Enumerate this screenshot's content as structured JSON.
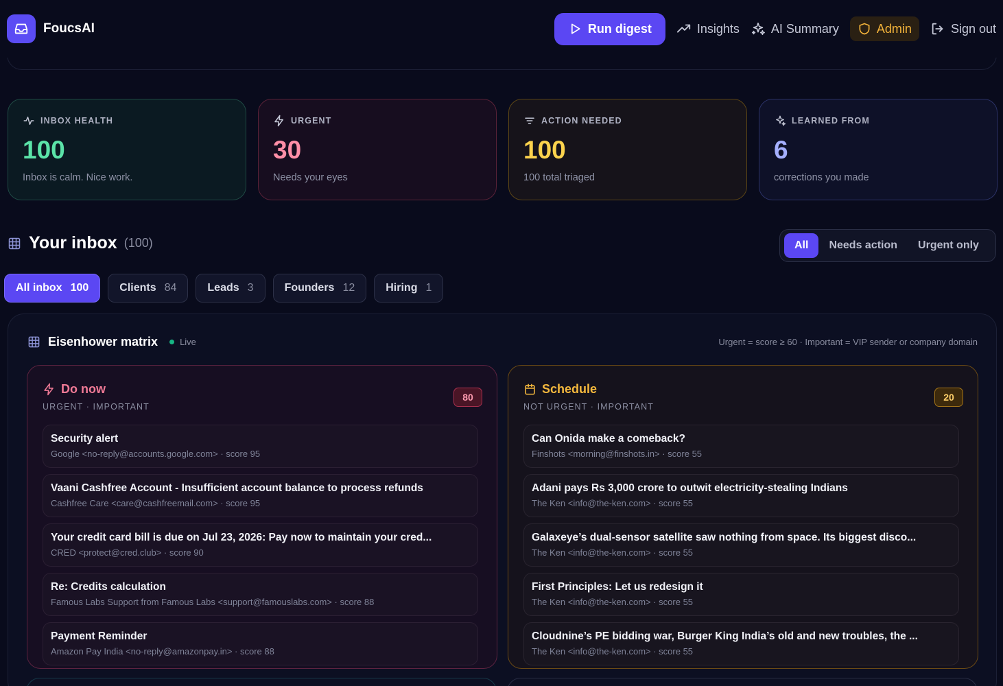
{
  "app": {
    "name": "FoucsAI"
  },
  "nav": {
    "run_digest": "Run digest",
    "insights": "Insights",
    "ai_summary": "AI Summary",
    "admin": "Admin",
    "sign_out": "Sign out"
  },
  "stats": [
    {
      "label": "INBOX HEALTH",
      "value": "100",
      "sub": "Inbox is calm. Nice work.",
      "color": "#5be3a8",
      "border": "#1f4a44",
      "icon": "pulse-icon"
    },
    {
      "label": "URGENT",
      "value": "30",
      "sub": "Needs your eyes",
      "color": "#ff8ea6",
      "border": "#5a2238",
      "icon": "bolt-icon"
    },
    {
      "label": "ACTION NEEDED",
      "value": "100",
      "sub": "100 total triaged",
      "color": "#fcd34d",
      "border": "#5b4516",
      "icon": "filter-icon"
    },
    {
      "label": "LEARNED FROM",
      "value": "6",
      "sub": "corrections you made",
      "color": "#a5b0ff",
      "border": "#2b3266",
      "icon": "sparkles-icon"
    }
  ],
  "inbox": {
    "title": "Your inbox",
    "count": "(100)",
    "segments": [
      "All",
      "Needs action",
      "Urgent only"
    ],
    "chips": [
      {
        "label": "All inbox",
        "n": "100"
      },
      {
        "label": "Clients",
        "n": "84"
      },
      {
        "label": "Leads",
        "n": "3"
      },
      {
        "label": "Founders",
        "n": "12"
      },
      {
        "label": "Hiring",
        "n": "1"
      }
    ]
  },
  "matrix": {
    "title": "Eisenhower matrix",
    "live": "Live",
    "rule": "Urgent = score ≥ 60 · Important = VIP sender or company domain",
    "do_now": {
      "title": "Do now",
      "sub": "URGENT · IMPORTANT",
      "count": "80",
      "items": [
        {
          "title": "Security alert",
          "meta": "Google <no-reply@accounts.google.com> · score 95"
        },
        {
          "title": "Vaani Cashfree Account - Insufficient account balance to process refunds",
          "meta": "Cashfree Care <care@cashfreemail.com> · score 95"
        },
        {
          "title": "Your credit card bill is due on Jul 23, 2026: Pay now to maintain your cred...",
          "meta": "CRED <protect@cred.club> · score 90"
        },
        {
          "title": "Re: Credits calculation",
          "meta": "Famous Labs Support from Famous Labs <support@famouslabs.com> · score 88"
        },
        {
          "title": "Payment Reminder",
          "meta": "Amazon Pay India <no-reply@amazonpay.in> · score 88"
        }
      ]
    },
    "schedule": {
      "title": "Schedule",
      "sub": "NOT URGENT · IMPORTANT",
      "count": "20",
      "items": [
        {
          "title": "Can Onida make a comeback?",
          "meta": "Finshots <morning@finshots.in> · score 55"
        },
        {
          "title": "Adani pays Rs 3,000 crore to outwit electricity-stealing Indians",
          "meta": "The Ken <info@the-ken.com> · score 55"
        },
        {
          "title": "Galaxeye’s dual-sensor satellite saw nothing from space. Its biggest disco...",
          "meta": "The Ken <info@the-ken.com> · score 55"
        },
        {
          "title": "First Principles: Let us redesign it",
          "meta": "The Ken <info@the-ken.com> · score 55"
        },
        {
          "title": "Cloudnine’s PE bidding war, Burger King India’s old and new troubles, the ...",
          "meta": "The Ken <info@the-ken.com> · score 55"
        }
      ]
    }
  }
}
